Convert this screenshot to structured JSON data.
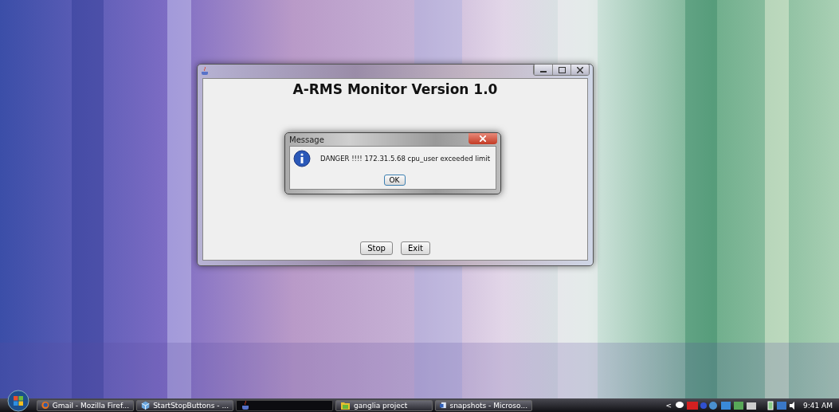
{
  "window": {
    "title": "A-RMS Monitor Version 1.0",
    "buttons": [
      {
        "label": "Stop"
      },
      {
        "label": "Exit"
      }
    ]
  },
  "dialog": {
    "title": "Message",
    "message": "DANGER !!!! 172.31.5.68 cpu_user exceeded limit",
    "button": "OK"
  },
  "taskbar": {
    "items": [
      {
        "label": "Gmail - Mozilla Firef...",
        "kind": "browser",
        "selected": false
      },
      {
        "label": "StartStopButtons - ...",
        "kind": "cube",
        "selected": false
      },
      {
        "kind": "java",
        "selected": true
      },
      {
        "label": "ganglia project",
        "kind": "folder",
        "selected": false
      },
      {
        "label": "snapshots - Microso...",
        "kind": "document",
        "selected": false
      }
    ],
    "tray_arrow": "<",
    "clock": "9:41 AM"
  }
}
